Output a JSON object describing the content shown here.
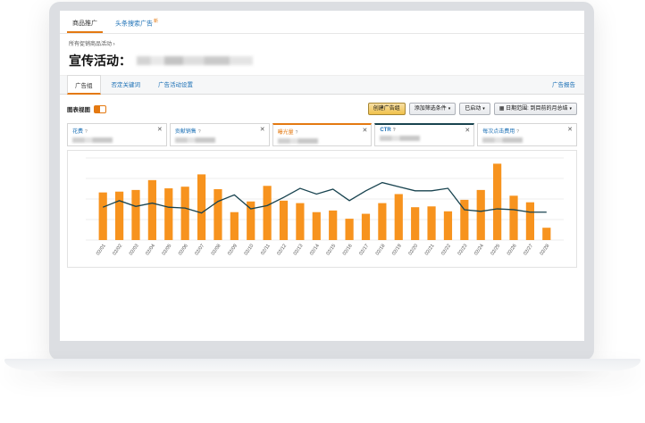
{
  "top_tabs": [
    {
      "label": "商品推广",
      "active": true
    },
    {
      "label": "头条搜索广告",
      "badge": "新",
      "active": false
    }
  ],
  "breadcrumb": "所有促销商品活动 ›",
  "page_title": "宣传活动：",
  "sub_tabs": [
    {
      "label": "广告组",
      "active": true
    },
    {
      "label": "否定关键词",
      "active": false
    },
    {
      "label": "广告活动设置",
      "active": false
    }
  ],
  "sub_tab_right": "广告报告",
  "toolbar": {
    "chart_view_label": "图表视图",
    "create_ad_group": "创建广告组",
    "add_filter": "添加筛选条件",
    "status": "已启动",
    "date_range": "日期范围: 到目前的月总结"
  },
  "metrics": [
    {
      "label": "花费",
      "state": "normal"
    },
    {
      "label": "贡献销售",
      "state": "normal"
    },
    {
      "label": "曝光量",
      "state": "selected-orange"
    },
    {
      "label": "CTR",
      "state": "selected-dark"
    },
    {
      "label": "每次点击费用",
      "state": "normal"
    }
  ],
  "colors": {
    "bar": "#f7931e",
    "line": "#18434f",
    "accent": "#e47911",
    "link": "#1a6fb5"
  },
  "chart_data": {
    "type": "bar",
    "categories": [
      "02/01",
      "02/02",
      "02/03",
      "02/04",
      "02/05",
      "02/06",
      "02/07",
      "02/08",
      "02/09",
      "02/10",
      "02/11",
      "02/12",
      "02/13",
      "02/14",
      "02/15",
      "02/16",
      "02/17",
      "02/18",
      "02/19",
      "02/20",
      "02/21",
      "02/22",
      "02/23",
      "02/24",
      "02/25",
      "02/26",
      "02/27",
      "02/28"
    ],
    "ylim": [
      0,
      100
    ],
    "grid": true,
    "series": [
      {
        "kind": "bar",
        "values": [
          58,
          59,
          61,
          73,
          63,
          65,
          80,
          62,
          34,
          47,
          66,
          48,
          45,
          34,
          36,
          26,
          32,
          45,
          56,
          40,
          41,
          35,
          49,
          61,
          93,
          54,
          46,
          15
        ]
      },
      {
        "kind": "line",
        "values": [
          40,
          48,
          41,
          45,
          40,
          39,
          33,
          47,
          55,
          38,
          42,
          52,
          63,
          56,
          62,
          48,
          60,
          70,
          65,
          60,
          60,
          63,
          37,
          35,
          38,
          37,
          34,
          34
        ]
      }
    ]
  }
}
